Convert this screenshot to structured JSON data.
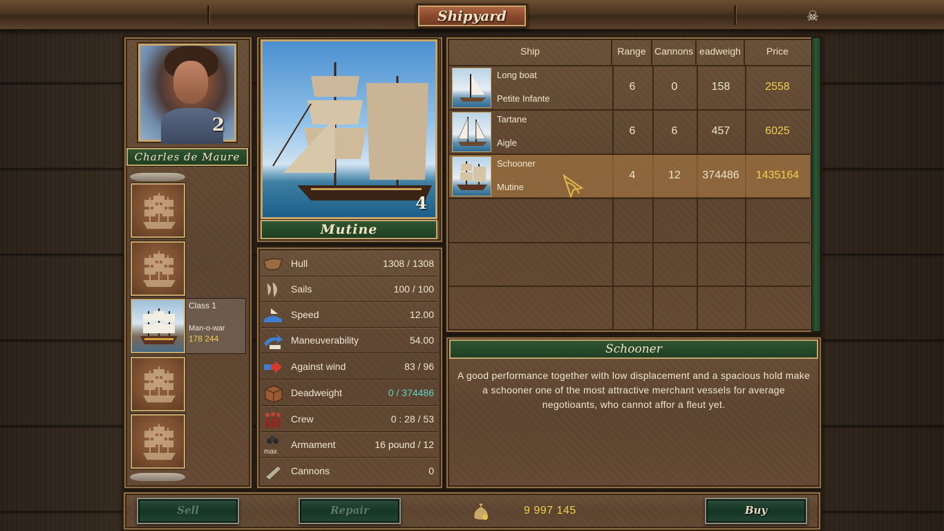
{
  "window": {
    "title": "Shipyard"
  },
  "captain": {
    "name": "Charles de Maure",
    "rank": "2"
  },
  "fleet_slot": {
    "class": "Class 1",
    "type": "Man-o-war",
    "value": "178 244"
  },
  "selected_ship": {
    "name": "Mutine",
    "class_number": "4"
  },
  "stats": [
    {
      "icon": "hull-icon",
      "label": "Hull",
      "value": "1308 / 1308"
    },
    {
      "icon": "sails-icon",
      "label": "Sails",
      "value": "100 / 100"
    },
    {
      "icon": "speed-icon",
      "label": "Speed",
      "value": "12.00"
    },
    {
      "icon": "maneuverability-icon",
      "label": "Maneuverability",
      "value": "54.00"
    },
    {
      "icon": "wind-icon",
      "label": "Against wind",
      "value": "83 / 96"
    },
    {
      "icon": "crate-icon",
      "label": "Deadweight",
      "value_prefix": "0",
      "value_sep": " / ",
      "value_suffix": "374486"
    },
    {
      "icon": "crew-icon",
      "label": "Crew",
      "value": "0 : 28 / 53"
    },
    {
      "icon": "cannonballs-icon",
      "label": "Armament",
      "value": "16 pound / 12",
      "icon_text": "max"
    },
    {
      "icon": "cannon-icon",
      "label": "Cannons",
      "value": "0"
    }
  ],
  "table": {
    "headers": [
      "Ship",
      "Range",
      "Cannons",
      "eadweigh",
      "Price"
    ],
    "rows": [
      {
        "type": "Long boat",
        "name": "Petite Infante",
        "range": "6",
        "cannons": "0",
        "deadweight": "158",
        "price": "2558"
      },
      {
        "type": "Tartane",
        "name": "Aigle",
        "range": "6",
        "cannons": "6",
        "deadweight": "457",
        "price": "6025"
      },
      {
        "type": "Schooner",
        "name": "Mutine",
        "range": "4",
        "cannons": "12",
        "deadweight": "374486",
        "price": "1435164"
      }
    ]
  },
  "description": {
    "title": "Schooner",
    "text": "A good performance together with low displacement and a spacious hold make a schooner one of the most attractive merchant vessels for average negotioants, who cannot affor a fleut yet."
  },
  "buttons": {
    "sell": "Sell",
    "repair": "Repair",
    "buy": "Buy"
  },
  "money": "9 997 145",
  "colors": {
    "gold": "#f1cf4e",
    "teal": "#5fd3c4",
    "green_plate": "#2f5530",
    "frame": "#c6a66c"
  }
}
